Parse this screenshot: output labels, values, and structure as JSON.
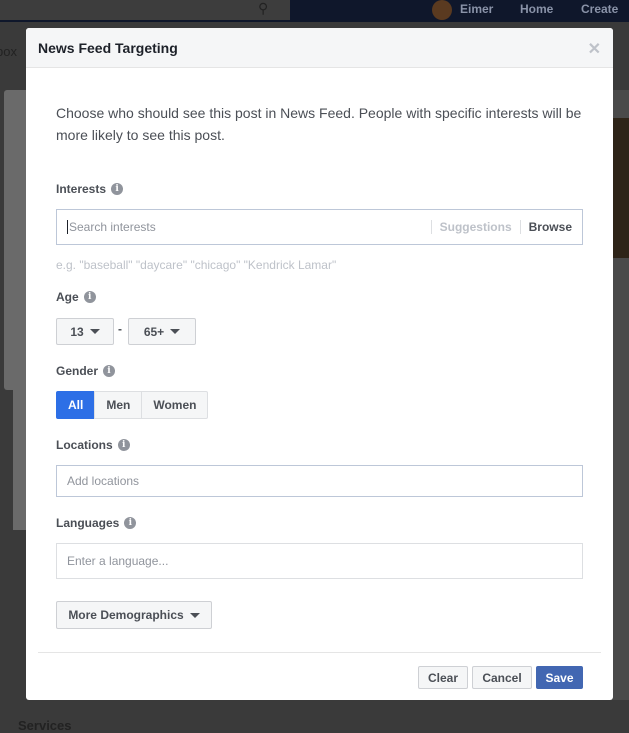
{
  "background": {
    "user_name": "Eimer",
    "nav_home": "Home",
    "nav_create": "Create",
    "left_fragment": "box",
    "bottom_fragment": "Services"
  },
  "dialog": {
    "title": "News Feed Targeting",
    "intro": "Choose who should see this post in News Feed. People with specific interests will be more likely to see this post.",
    "interests": {
      "label": "Interests",
      "placeholder": "Search interests",
      "suggestions": "Suggestions",
      "browse": "Browse",
      "hint": "e.g. \"baseball\" \"daycare\" \"chicago\" \"Kendrick Lamar\""
    },
    "age": {
      "label": "Age",
      "min": "13",
      "separator": "-",
      "max": "65+"
    },
    "gender": {
      "label": "Gender",
      "options": [
        "All",
        "Men",
        "Women"
      ],
      "selected": "All"
    },
    "locations": {
      "label": "Locations",
      "placeholder": "Add locations"
    },
    "languages": {
      "label": "Languages",
      "placeholder": "Enter a language..."
    },
    "more_demographics": "More Demographics",
    "buttons": {
      "clear": "Clear",
      "cancel": "Cancel",
      "save": "Save"
    }
  },
  "colors": {
    "accent": "#4267b2",
    "selected": "#2d6fe6"
  }
}
